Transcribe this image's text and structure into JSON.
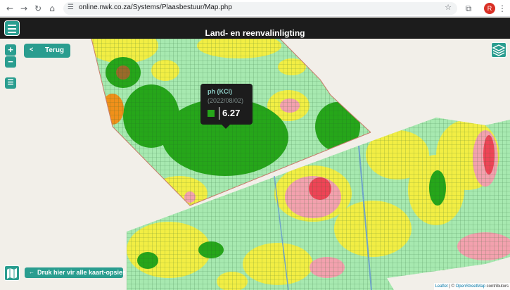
{
  "browser": {
    "url": "online.nwk.co.za/Systems/Plaasbestuur/Map.php",
    "avatar_letter": "R"
  },
  "app": {
    "title": "Land- en reenvalinligting",
    "back_label": "Terug",
    "zoom_in": "+",
    "zoom_out": "−",
    "map_options_label": "Druk hier vir alle kaart-opsies"
  },
  "tooltip": {
    "title": "ph (KCl)",
    "date": "(2022/08/02)",
    "value": "6.27",
    "swatch_color": "#26a61a"
  },
  "attribution": {
    "leaflet": "Leaflet",
    "separator": "|",
    "copyright": "©",
    "osm": "OpenStreetMap",
    "suffix": "contributors"
  },
  "colors": {
    "accent": "#2a9d8f",
    "dark_green": "#26a61a",
    "light_green": "#a7e9b0",
    "yellow": "#f2ee44",
    "pink": "#f3a1ae",
    "red": "#ee4456",
    "orange": "#f0901a",
    "brown": "#9a6a2a",
    "background": "#f2efe9"
  }
}
